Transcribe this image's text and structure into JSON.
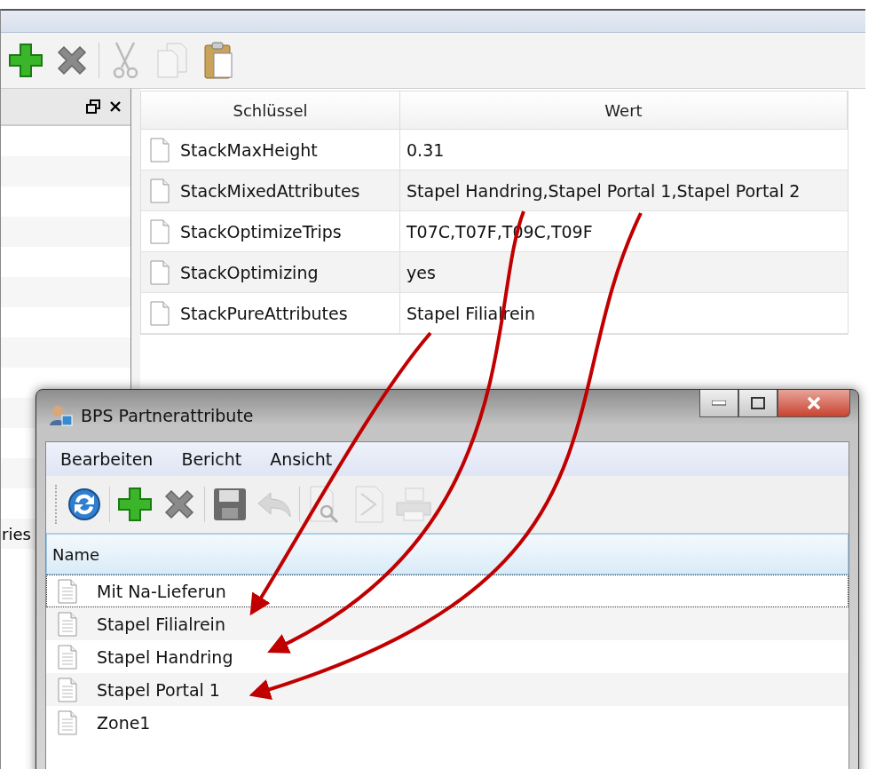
{
  "main_window": {
    "toolbar": [
      {
        "kind": "add",
        "disabled": false
      },
      {
        "kind": "delete",
        "disabled": false
      },
      {
        "kind": "separator"
      },
      {
        "kind": "cut",
        "disabled": true
      },
      {
        "kind": "copy",
        "disabled": true
      },
      {
        "kind": "paste",
        "disabled": false
      }
    ],
    "side_panel": {
      "partial_label": "ries"
    },
    "properties_table": {
      "columns": [
        "Schlüssel",
        "Wert"
      ],
      "rows": [
        {
          "key": "StackMaxHeight",
          "value": "0.31"
        },
        {
          "key": "StackMixedAttributes",
          "value": "Stapel Handring,Stapel Portal 1,Stapel Portal 2"
        },
        {
          "key": "StackOptimizeTrips",
          "value": "T07C,T07F,T09C,T09F"
        },
        {
          "key": "StackOptimizing",
          "value": "yes"
        },
        {
          "key": "StackPureAttributes",
          "value": "Stapel Filialrein"
        }
      ]
    }
  },
  "dialog": {
    "title": "BPS Partnerattribute",
    "menu": [
      "Bearbeiten",
      "Bericht",
      "Ansicht"
    ],
    "toolbar": [
      {
        "kind": "refresh",
        "disabled": false
      },
      {
        "kind": "separator"
      },
      {
        "kind": "add",
        "disabled": false
      },
      {
        "kind": "delete",
        "disabled": false
      },
      {
        "kind": "separator"
      },
      {
        "kind": "save",
        "disabled": false
      },
      {
        "kind": "undo",
        "disabled": true
      },
      {
        "kind": "separator"
      },
      {
        "kind": "preview",
        "disabled": true
      },
      {
        "kind": "pdf",
        "disabled": true
      },
      {
        "kind": "print",
        "disabled": true
      }
    ],
    "list": {
      "column": "Name",
      "items": [
        {
          "label": "Mit Na-Lieferun",
          "focused": true
        },
        {
          "label": "Stapel Filialrein",
          "focused": false
        },
        {
          "label": "Stapel Handring",
          "focused": false
        },
        {
          "label": "Stapel Portal 1",
          "focused": false
        },
        {
          "label": "Zone1",
          "focused": false
        }
      ]
    }
  }
}
